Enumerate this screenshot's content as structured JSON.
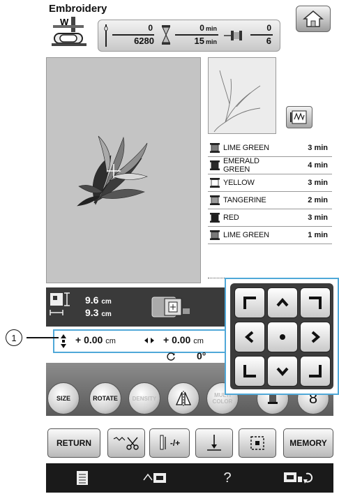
{
  "title": "Embroidery",
  "callout": {
    "number": "1"
  },
  "counter": {
    "stitch_current": "0",
    "stitch_total": "6280",
    "time_current": "0",
    "time_total": "15",
    "time_unit": "min",
    "color_current": "0",
    "color_total": "6"
  },
  "colors": [
    {
      "name": "LIME GREEN",
      "time": "3 min",
      "swatch": "#7a7a7a"
    },
    {
      "name": "EMERALD GREEN",
      "time": "4 min",
      "swatch": "#2a2a2a"
    },
    {
      "name": "YELLOW",
      "time": "3 min",
      "swatch": "#ffffff"
    },
    {
      "name": "TANGERINE",
      "time": "2 min",
      "swatch": "#9a9a9a"
    },
    {
      "name": "RED",
      "time": "3 min",
      "swatch": "#1e1e1e"
    },
    {
      "name": "LIME GREEN",
      "time": "1 min",
      "swatch": "#7a7a7a"
    }
  ],
  "size_info": {
    "width": "9.6",
    "height": "9.3",
    "unit": "cm"
  },
  "position": {
    "vertical_value": "+ 0.00",
    "horizontal_value": "+ 0.00",
    "unit": "cm",
    "angle": "0°"
  },
  "round_buttons": {
    "size": "SIZE",
    "rotate": "ROTATE",
    "density": "DENSITY",
    "multi_color": "MULTI COLOR",
    "eight": "8"
  },
  "square_buttons": {
    "return": "RETURN",
    "needle": "-/+",
    "memory": "MEMORY"
  },
  "bottom_bar": {
    "help": "?"
  },
  "colors_theme": {
    "highlight": "#4fa8d8",
    "dark_panel": "#3a3a3a"
  }
}
